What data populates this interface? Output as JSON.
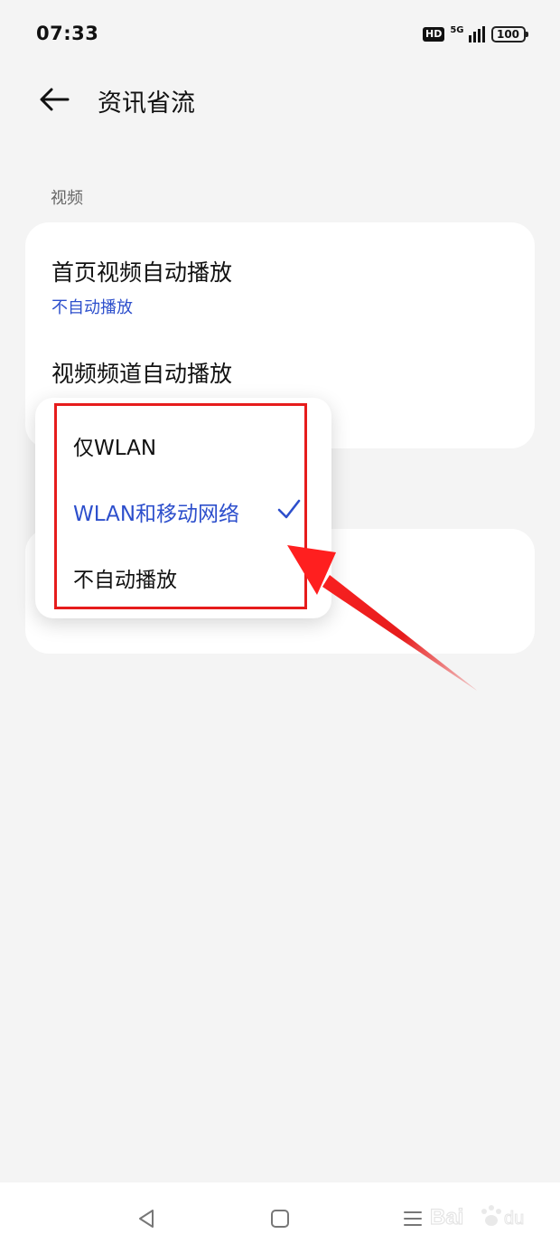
{
  "status_bar": {
    "time": "07:33",
    "hd_badge": "HD",
    "network": "5G",
    "battery": "100"
  },
  "header": {
    "title": "资讯省流"
  },
  "section": {
    "label": "视频"
  },
  "settings": {
    "items": [
      {
        "title": "首页视频自动播放",
        "value": "不自动播放"
      },
      {
        "title": "视频频道自动播放"
      }
    ]
  },
  "popup": {
    "options": [
      "仅WLAN",
      "WLAN和移动网络",
      "不自动播放"
    ],
    "selected_index": 1
  },
  "colors": {
    "accent": "#2d4fcc",
    "annotation": "#e61c1c",
    "background": "#f4f4f4"
  },
  "nav_icons": [
    "back-triangle-icon",
    "home-square-icon",
    "recents-lines-icon"
  ]
}
